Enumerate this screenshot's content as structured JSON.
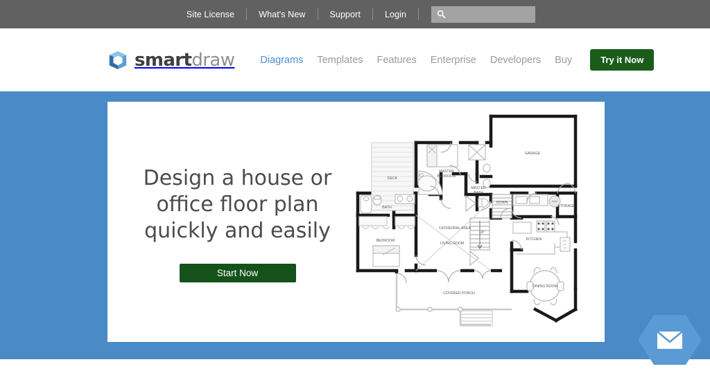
{
  "topbar": {
    "links": [
      {
        "label": "Site License"
      },
      {
        "label": "What's New"
      },
      {
        "label": "Support"
      },
      {
        "label": "Login"
      }
    ],
    "search": {
      "value": "",
      "placeholder": ""
    },
    "bg_color": "#616161"
  },
  "nav": {
    "brand": {
      "smart": "smart",
      "draw": "draw"
    },
    "links": [
      {
        "label": "Diagrams",
        "active": true
      },
      {
        "label": "Templates",
        "active": false
      },
      {
        "label": "Features",
        "active": false
      },
      {
        "label": "Enterprise",
        "active": false
      },
      {
        "label": "Developers",
        "active": false
      },
      {
        "label": "Buy",
        "active": false
      }
    ],
    "cta": {
      "label": "Try it Now",
      "color": "#1a5c1a"
    }
  },
  "hero": {
    "title": "Design a house or office floor plan quickly and easily",
    "cta": {
      "label": "Start Now",
      "color": "#14521a"
    },
    "bg_color": "#4a8bc7",
    "card_color": "#ffffff"
  },
  "floorplan": {
    "rooms": [
      {
        "name": "DECK"
      },
      {
        "name": "MASTER BEDROOM"
      },
      {
        "name": "MASTER BATH"
      },
      {
        "name": "GARAGE"
      },
      {
        "name": "STORAGE"
      },
      {
        "name": "BATH"
      },
      {
        "name": "BEDROOM"
      },
      {
        "name": "CATHEDRAL AREA"
      },
      {
        "name": "LIVING ROOM"
      },
      {
        "name": "KITCHEN"
      },
      {
        "name": "DINING ROOM"
      },
      {
        "name": "COVERED PORCH"
      }
    ],
    "stair_labels": [
      {
        "name": "DOWN"
      },
      {
        "name": "UP"
      }
    ]
  },
  "email_widget": {
    "icon": "envelope-icon",
    "hex_color": "#4a8bc7",
    "badge_color": "#5b9bd5"
  }
}
